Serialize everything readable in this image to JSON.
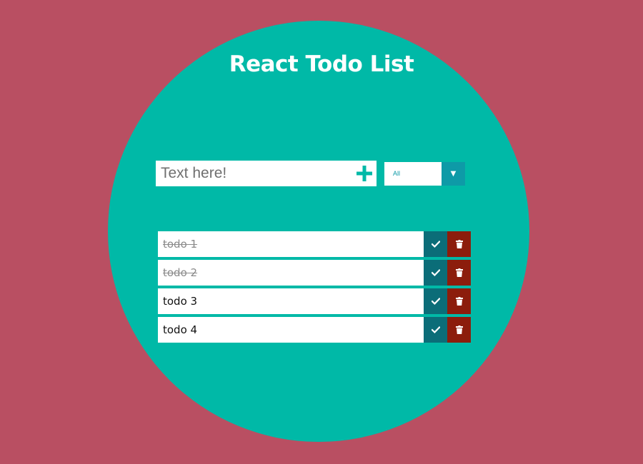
{
  "app": {
    "title": "React Todo List"
  },
  "add_form": {
    "placeholder": "Text here!",
    "value": ""
  },
  "filter": {
    "selected": "All"
  },
  "todos": [
    {
      "text": "todo 1",
      "completed": true
    },
    {
      "text": "todo 2",
      "completed": true
    },
    {
      "text": "todo 3",
      "completed": false
    },
    {
      "text": "todo 4",
      "completed": false
    }
  ],
  "icons": {
    "add": "plus-icon",
    "filter_dropdown": "triangle-down-icon",
    "complete": "check-icon",
    "delete": "trash-icon"
  },
  "colors": {
    "page_background": "#b94f62",
    "circle": "#00b9a7",
    "accent": "#0e9aa7",
    "complete_button": "#0b6d78",
    "delete_button": "#8c1d0c",
    "add_icon": "#00b9a7"
  }
}
